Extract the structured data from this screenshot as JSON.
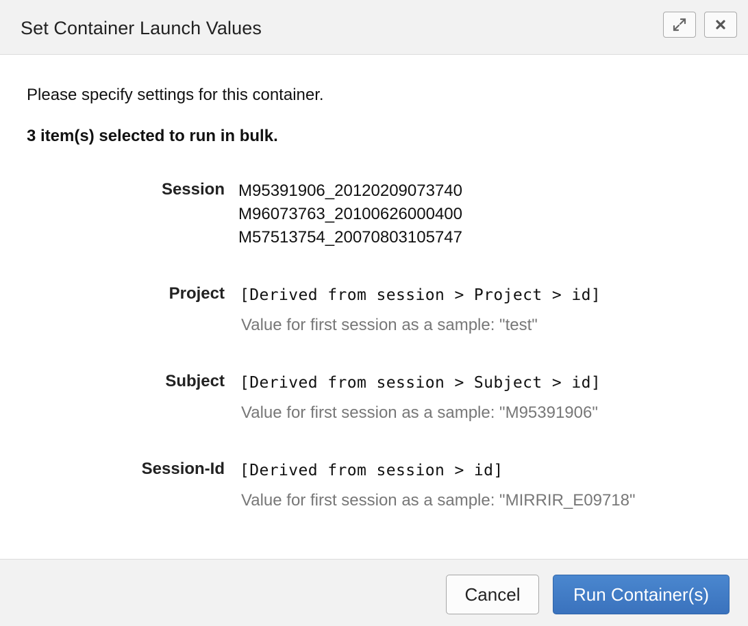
{
  "dialog": {
    "title": "Set Container Launch Values",
    "buttons": {
      "maximize_icon": "maximize-icon",
      "close_icon": "close-icon"
    }
  },
  "content": {
    "intro": "Please specify settings for this container.",
    "bulk_notice": "3 item(s) selected to run in bulk.",
    "session": {
      "label": "Session",
      "values": [
        "M95391906_20120209073740",
        "M96073763_20100626000400",
        "M57513754_20070803105747"
      ]
    },
    "fields": [
      {
        "label": "Project",
        "derived": "[Derived from session > Project > id]",
        "sample": "Value for first session as a sample: \"test\""
      },
      {
        "label": "Subject",
        "derived": "[Derived from session > Subject > id]",
        "sample": "Value for first session as a sample: \"M95391906\""
      },
      {
        "label": "Session-Id",
        "derived": "[Derived from session > id]",
        "sample": "Value for first session as a sample: \"MIRRIR_E09718\""
      }
    ]
  },
  "footer": {
    "cancel_label": "Cancel",
    "run_label": "Run Container(s)"
  },
  "colors": {
    "primary": "#3f7cc6",
    "header_bg": "#f2f2f2",
    "muted_text": "#777777"
  }
}
